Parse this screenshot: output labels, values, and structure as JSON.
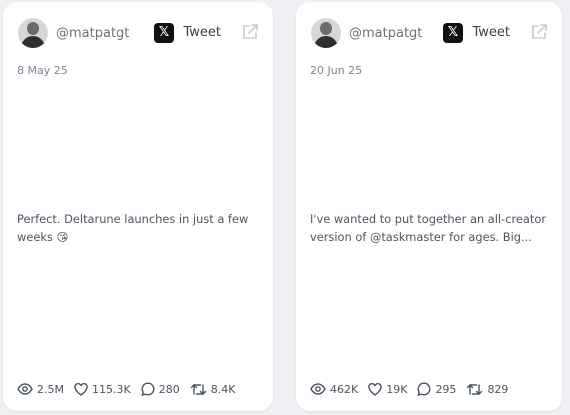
{
  "cards": [
    {
      "handle": "@matpatgt",
      "tweet_label": "Tweet",
      "x_logo": "𝕏",
      "date": "8 May 25",
      "text": "Perfect. Deltarune launches in just a few weeks 😘",
      "stats": {
        "views": "2.5M",
        "likes": "115.3K",
        "replies": "280",
        "retweets": "8.4K"
      }
    },
    {
      "handle": "@matpatgt",
      "tweet_label": "Tweet",
      "x_logo": "𝕏",
      "date": "20 Jun 25",
      "text": "I've wanted to put together an all-creator version of @taskmaster for ages. Big...",
      "stats": {
        "views": "462K",
        "likes": "19K",
        "replies": "295",
        "retweets": "829"
      }
    }
  ],
  "icons": {
    "views": "eye-icon",
    "likes": "heart-icon",
    "replies": "comment-icon",
    "retweets": "retweet-icon",
    "external": "external-link-icon"
  }
}
